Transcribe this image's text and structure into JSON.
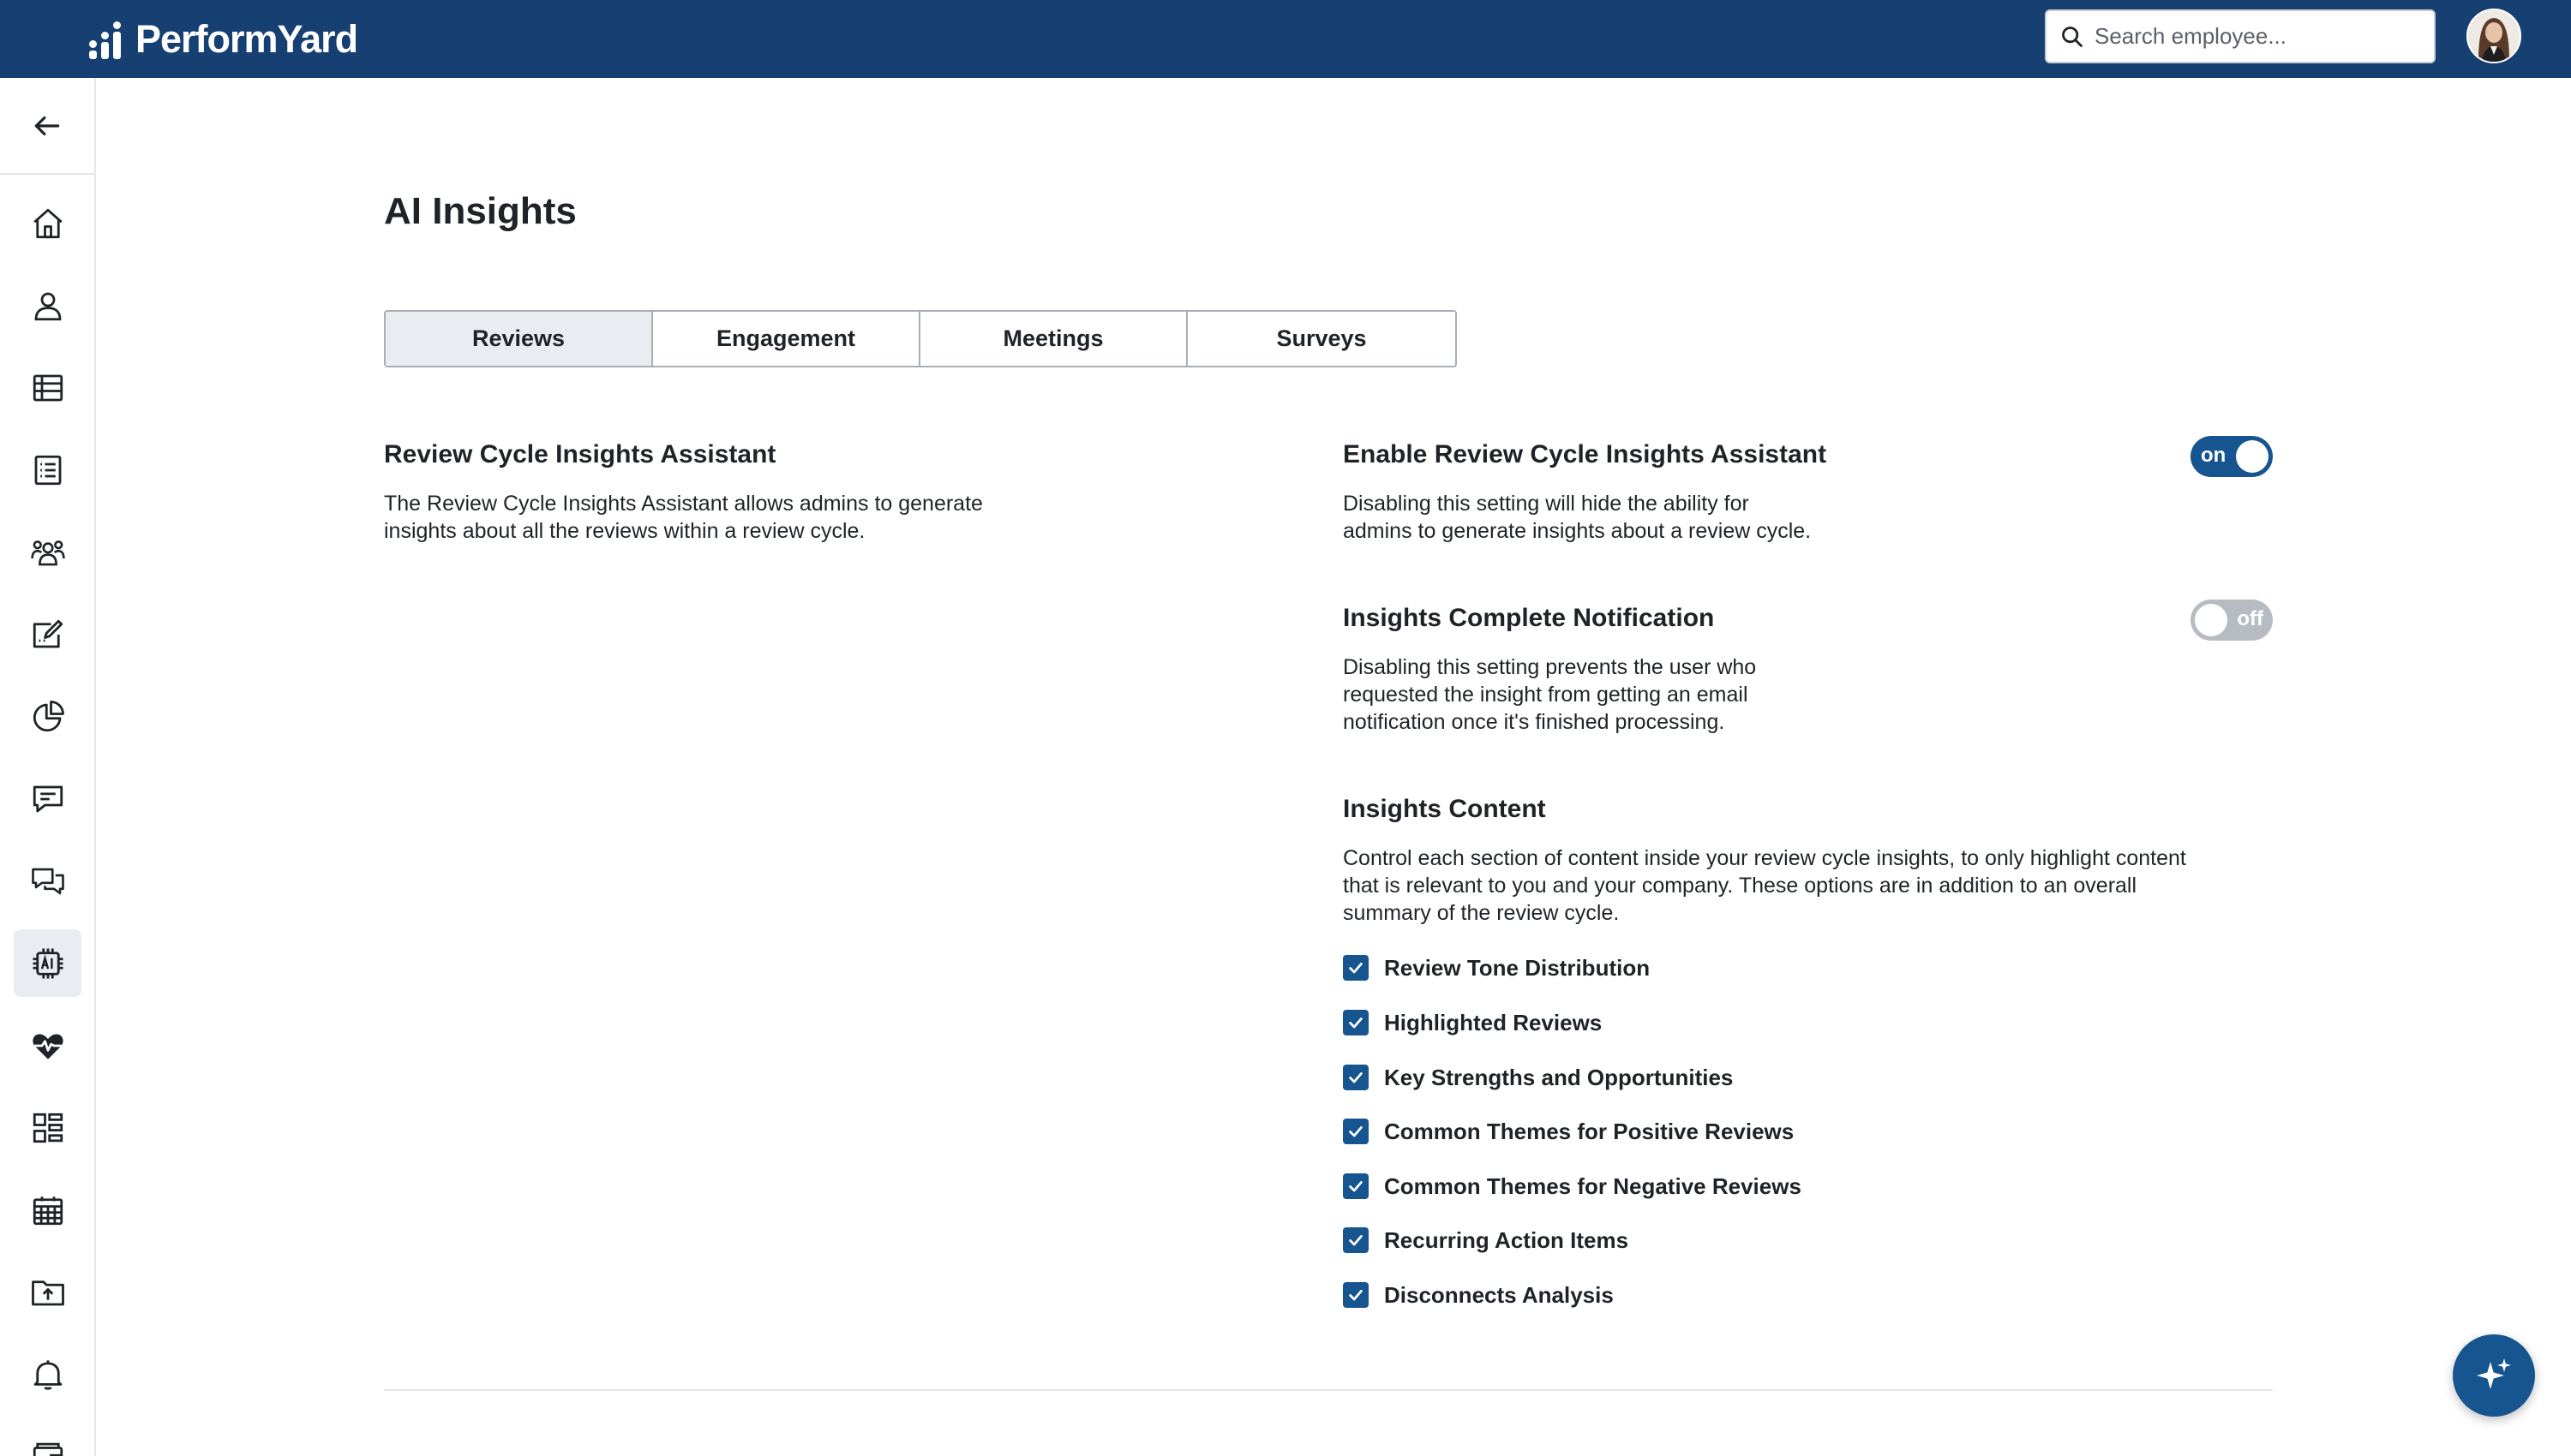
{
  "header": {
    "brand": "PerformYard",
    "search_placeholder": "Search employee..."
  },
  "sidebar": {
    "items": [
      {
        "icon": "home-icon"
      },
      {
        "icon": "person-icon"
      },
      {
        "icon": "table-icon"
      },
      {
        "icon": "list-icon"
      },
      {
        "icon": "team-icon"
      },
      {
        "icon": "edit-icon"
      },
      {
        "icon": "pie-chart-icon"
      },
      {
        "icon": "comment-icon"
      },
      {
        "icon": "conversations-icon"
      },
      {
        "icon": "ai-chip-icon",
        "active": true
      },
      {
        "icon": "heartbeat-icon"
      },
      {
        "icon": "dashboard-icon"
      },
      {
        "icon": "calendar-icon"
      },
      {
        "icon": "folder-upload-icon"
      },
      {
        "icon": "bell-icon"
      },
      {
        "icon": "wallet-icon"
      }
    ]
  },
  "page": {
    "title": "AI Insights",
    "tabs": [
      {
        "label": "Reviews",
        "active": true
      },
      {
        "label": "Engagement"
      },
      {
        "label": "Meetings"
      },
      {
        "label": "Surveys"
      }
    ]
  },
  "left_section": {
    "title": "Review Cycle Insights Assistant",
    "description_lines": [
      "The Review Cycle Insights Assistant allows admins to generate",
      "insights about all the reviews within a review cycle."
    ]
  },
  "settings": {
    "enable": {
      "title": "Enable Review Cycle Insights Assistant",
      "description_lines": [
        "Disabling this setting will hide the ability for",
        "admins to generate insights about a review cycle."
      ],
      "toggle_label": "on"
    },
    "notification": {
      "title": "Insights Complete Notification",
      "description_lines": [
        "Disabling this setting prevents the user who",
        "requested the insight from getting an email",
        "notification once it's finished processing."
      ],
      "toggle_label": "off"
    },
    "content": {
      "title": "Insights Content",
      "description_lines": [
        "Control each section of content inside your review cycle insights, to only highlight content",
        "that is relevant to you and your company. These options are in addition to an overall",
        "summary of the review cycle."
      ],
      "options": [
        {
          "label": "Review Tone Distribution",
          "checked": true
        },
        {
          "label": "Highlighted Reviews",
          "checked": true
        },
        {
          "label": "Key Strengths and Opportunities",
          "checked": true
        },
        {
          "label": "Common Themes for Positive Reviews",
          "checked": true
        },
        {
          "label": "Common Themes for Negative Reviews",
          "checked": true
        },
        {
          "label": "Recurring Action Items",
          "checked": true
        },
        {
          "label": "Disconnects Analysis",
          "checked": true
        }
      ]
    }
  },
  "colors": {
    "header_bg": "#163f72",
    "accent": "#16558f",
    "toggle_off": "#b7bcc3"
  }
}
